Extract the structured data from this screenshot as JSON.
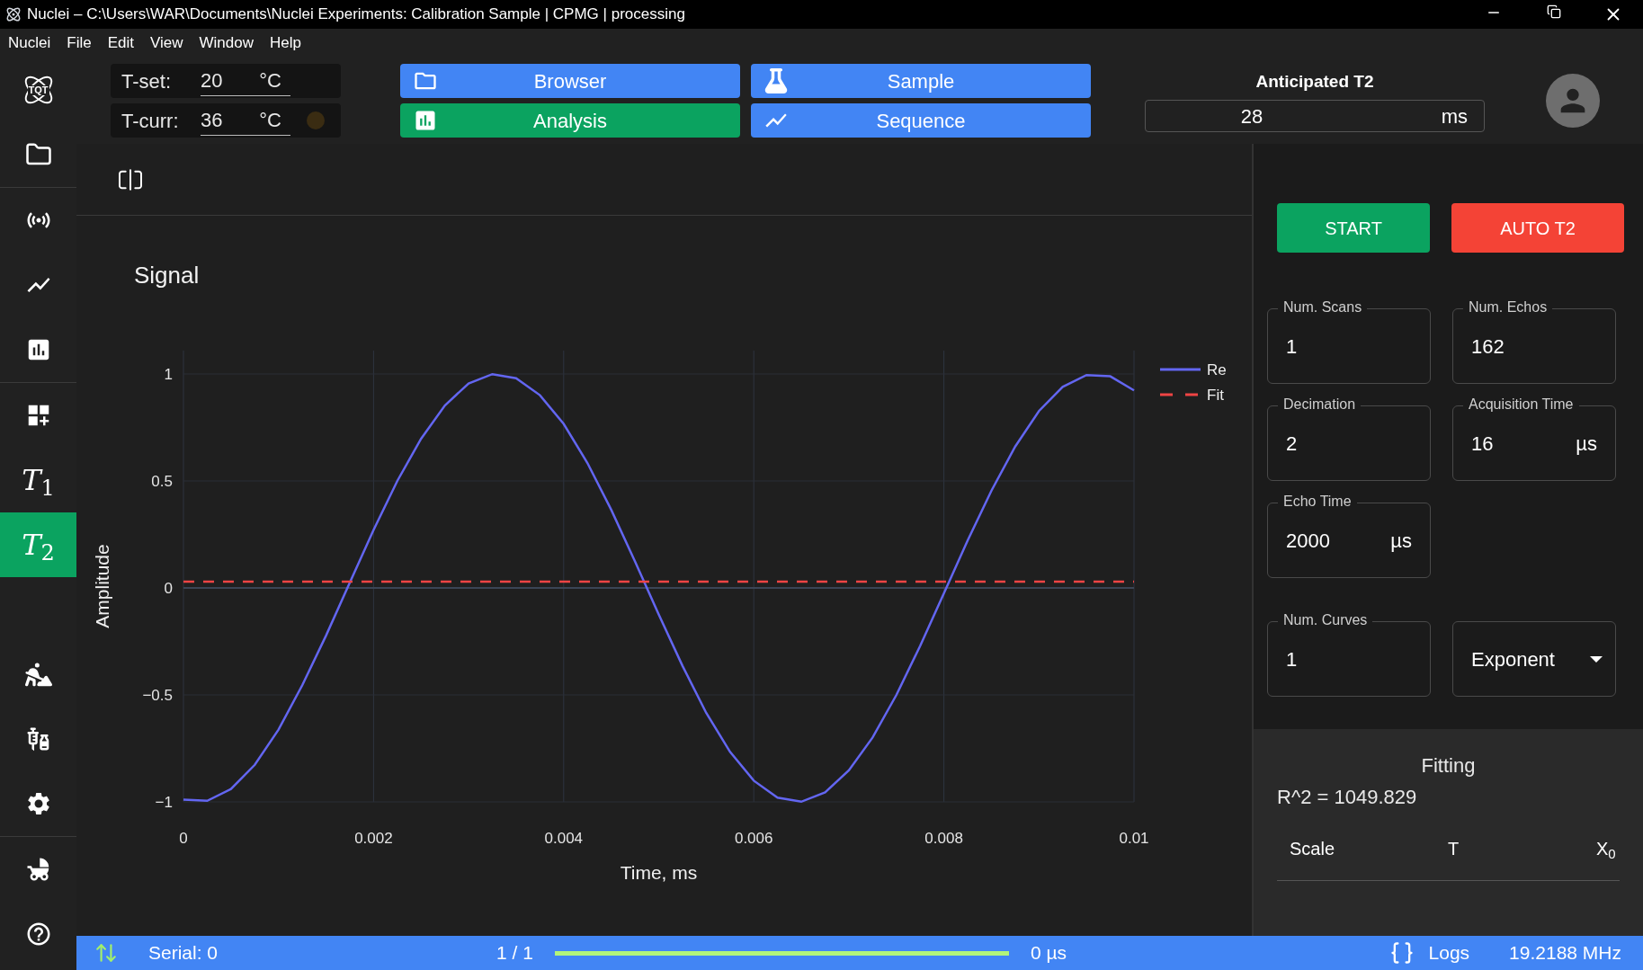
{
  "window": {
    "title": "Nuclei – C:\\Users\\WAR\\Documents\\Nuclei Experiments: Calibration Sample | CPMG | processing"
  },
  "menu": [
    "Nuclei",
    "File",
    "Edit",
    "View",
    "Window",
    "Help"
  ],
  "sidebar": {
    "logo": "TQT",
    "items": [
      {
        "selected": false
      },
      {
        "selected": false
      },
      {
        "selected": false
      },
      {
        "selected": false
      },
      {
        "selected": false
      },
      {
        "label": "*T*$_{1}$",
        "selected": false
      },
      {
        "label": "*T*$_{2}$",
        "selected": true
      },
      {
        "selected": false
      },
      {
        "selected": false
      },
      {
        "selected": false
      },
      {
        "selected": false
      },
      {
        "selected": false
      }
    ]
  },
  "temperature": [
    {
      "label": "T-set:",
      "value": "20",
      "unit": "°C"
    },
    {
      "label": "T-curr:",
      "value": "36",
      "unit": "°C",
      "indicator_on": false
    }
  ],
  "nav_buttons": [
    {
      "label": "Browser",
      "selected": false
    },
    {
      "label": "Sample",
      "selected": false
    },
    {
      "label": "Analysis",
      "selected": true
    },
    {
      "label": "Sequence",
      "selected": false
    }
  ],
  "anticipated_t2": {
    "label": "Anticipated T2",
    "value": "28",
    "unit": "ms"
  },
  "chart": {
    "title": "Signal",
    "chart_data": {
      "type": "line",
      "xlabel": "Time, ms",
      "ylabel": "Amplitude",
      "x": [
        0,
        0.00025,
        0.0005,
        0.00075,
        0.001,
        0.00125,
        0.0015,
        0.00175,
        0.002,
        0.00225,
        0.0025,
        0.00275,
        0.003,
        0.00325,
        0.0035,
        0.00375,
        0.004,
        0.00425,
        0.0045,
        0.00475,
        0.005,
        0.00525,
        0.0055,
        0.00575,
        0.006,
        0.00625,
        0.0065,
        0.00675,
        0.007,
        0.00725,
        0.0075,
        0.00775,
        0.008,
        0.00825,
        0.0085,
        0.00875,
        0.009,
        0.00925,
        0.0095,
        0.00975,
        0.01
      ],
      "series": [
        {
          "name": "Re",
          "color": "#6366f1",
          "line_style": "solid",
          "values": [
            -0.989,
            -0.995,
            -0.94,
            -0.827,
            -0.662,
            -0.455,
            -0.223,
            0.025,
            0.271,
            0.5,
            0.698,
            0.853,
            0.956,
            0.999,
            0.98,
            0.901,
            0.767,
            0.584,
            0.366,
            0.124,
            -0.124,
            -0.364,
            -0.584,
            -0.766,
            -0.901,
            -0.98,
            -0.999,
            -0.956,
            -0.853,
            -0.699,
            -0.5,
            -0.271,
            -0.025,
            0.222,
            0.455,
            0.661,
            0.827,
            0.94,
            0.995,
            0.989,
            0.923
          ]
        },
        {
          "name": "Fit",
          "color": "#ef4444",
          "line_style": "dashed",
          "values": [
            0.03,
            0.03,
            0.03,
            0.03,
            0.03,
            0.03,
            0.03,
            0.03,
            0.03,
            0.03,
            0.03,
            0.03,
            0.03,
            0.03,
            0.03,
            0.03,
            0.03,
            0.03,
            0.03,
            0.03,
            0.03,
            0.03,
            0.03,
            0.03,
            0.03,
            0.03,
            0.03,
            0.03,
            0.03,
            0.03,
            0.03,
            0.03,
            0.03,
            0.03,
            0.03,
            0.03,
            0.03,
            0.03,
            0.03,
            0.03,
            0.03
          ]
        }
      ],
      "xlim": [
        0,
        0.01
      ],
      "ylim": [
        -1,
        1
      ],
      "grid": true,
      "legend": true,
      "xticks": [
        0,
        0.002,
        0.004,
        0.006,
        0.008,
        0.01
      ],
      "yticks": [
        {
          "value": -1,
          "label": "−1"
        },
        {
          "value": -0.5,
          "label": "−0.5"
        },
        0,
        0.5,
        1
      ]
    }
  },
  "actions": [
    {
      "label": "START",
      "kind": "start"
    },
    {
      "label": "AUTO T2",
      "kind": "auto"
    }
  ],
  "fields": [
    {
      "label": "Num. Scans",
      "value": "1"
    },
    {
      "label": "Num. Echos",
      "value": "162"
    },
    {
      "label": "Decimation",
      "value": "2"
    },
    {
      "label": "Acquisition Time",
      "value": "16",
      "unit": "µs"
    },
    {
      "label": "Echo Time",
      "value": "2000",
      "unit": "µs"
    }
  ],
  "curves": {
    "label": "Num. Curves",
    "value": "1",
    "model": "Exponent"
  },
  "fitting": {
    "title": "Fitting",
    "r2": "R^2 = 1049.829",
    "columns": [
      "Scale",
      "T",
      "X$_{0}$"
    ]
  },
  "status_bar": {
    "serial": "Serial: 0",
    "count": "1 / 1",
    "level": 1,
    "time": "0 µs",
    "logs": "Logs",
    "frequency": "19.2188 MHz"
  }
}
